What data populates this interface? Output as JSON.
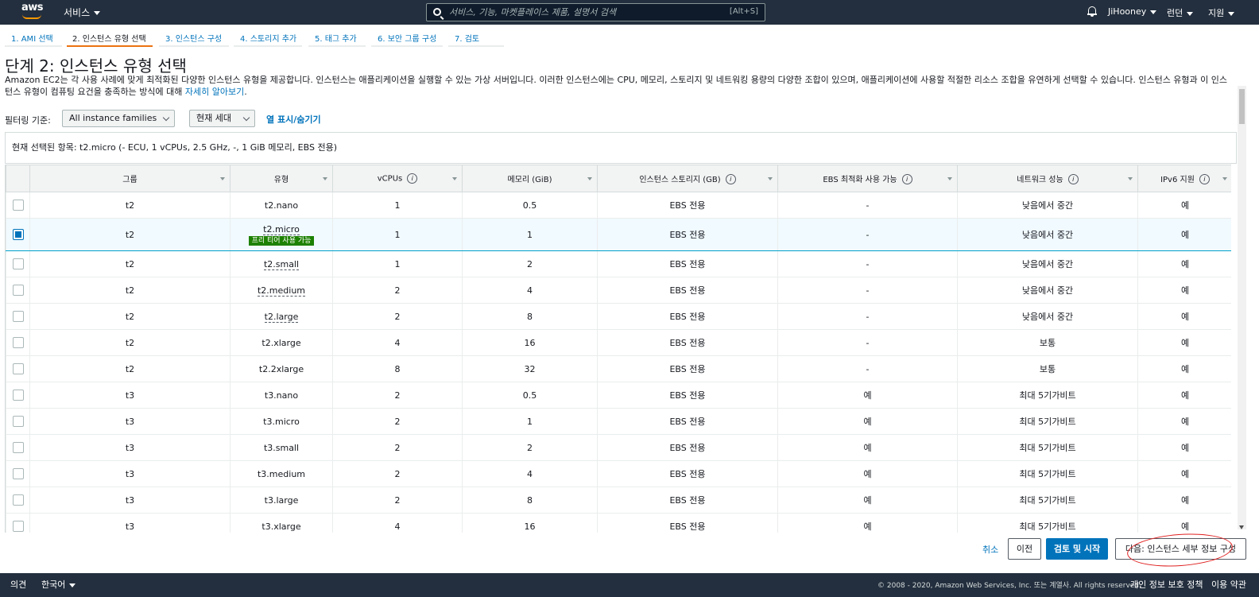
{
  "nav": {
    "logo": "aws",
    "services": "서비스",
    "search_placeholder": "서비스, 기능, 마켓플레이스 제품, 설명서 검색",
    "search_shortcut": "[Alt+S]",
    "user": "JiHooney",
    "region": "런던",
    "support": "지원"
  },
  "steps": [
    {
      "label": "1. AMI 선택"
    },
    {
      "label": "2. 인스턴스 유형 선택"
    },
    {
      "label": "3. 인스턴스 구성"
    },
    {
      "label": "4. 스토리지 추가"
    },
    {
      "label": "5. 태그 추가"
    },
    {
      "label": "6. 보안 그룹 구성"
    },
    {
      "label": "7. 검토"
    }
  ],
  "page": {
    "title": "단계 2: 인스턴스 유형 선택",
    "description": "Amazon EC2는 각 사용 사례에 맞게 최적화된 다양한 인스턴스 유형을 제공합니다. 인스턴스는 애플리케이션을 실행할 수 있는 가상 서버입니다. 이러한 인스턴스에는 CPU, 메모리, 스토리지 및 네트워킹 용량의 다양한 조합이 있으며, 애플리케이션에 사용할 적절한 리소스 조합을 유연하게 선택할 수 있습니다. 인스턴스 유형과 이 인스턴스 유형이 컴퓨팅 요건을 충족하는 방식에 대해",
    "learn_more": "자세히 알아보기",
    "desc_end": ".",
    "filter_label": "필터링 기준:",
    "filter_family": "All instance families",
    "filter_generation": "현재 세대",
    "toggle_columns": "열 표시/숨기기",
    "selected_text": "현재 선택된 항목: t2.micro (- ECU, 1 vCPUs, 2.5 GHz, -, 1 GiB 메모리, EBS 전용)"
  },
  "table": {
    "headers": {
      "group": "그룹",
      "type": "유형",
      "vcpus": "vCPUs",
      "memory": "메모리 (GiB)",
      "storage": "인스턴스 스토리지 (GB)",
      "ebs": "EBS 최적화 사용 가능",
      "network": "네트워크 성능",
      "ipv6": "IPv6 지원"
    },
    "info_glyph": "i",
    "free_tier_label": "프리 티어 사용 가능",
    "rows": [
      {
        "group": "t2",
        "type": "t2.nano",
        "vcpus": "1",
        "memory": "0.5",
        "storage": "EBS 전용",
        "ebs": "-",
        "network": "낮음에서 중간",
        "ipv6": "예",
        "selected": false,
        "dotted": false
      },
      {
        "group": "t2",
        "type": "t2.micro",
        "vcpus": "1",
        "memory": "1",
        "storage": "EBS 전용",
        "ebs": "-",
        "network": "낮음에서 중간",
        "ipv6": "예",
        "selected": true,
        "dotted": true,
        "free": true
      },
      {
        "group": "t2",
        "type": "t2.small",
        "vcpus": "1",
        "memory": "2",
        "storage": "EBS 전용",
        "ebs": "-",
        "network": "낮음에서 중간",
        "ipv6": "예",
        "selected": false,
        "dotted": true
      },
      {
        "group": "t2",
        "type": "t2.medium",
        "vcpus": "2",
        "memory": "4",
        "storage": "EBS 전용",
        "ebs": "-",
        "network": "낮음에서 중간",
        "ipv6": "예",
        "selected": false,
        "dotted": true
      },
      {
        "group": "t2",
        "type": "t2.large",
        "vcpus": "2",
        "memory": "8",
        "storage": "EBS 전용",
        "ebs": "-",
        "network": "낮음에서 중간",
        "ipv6": "예",
        "selected": false,
        "dotted": true
      },
      {
        "group": "t2",
        "type": "t2.xlarge",
        "vcpus": "4",
        "memory": "16",
        "storage": "EBS 전용",
        "ebs": "-",
        "network": "보통",
        "ipv6": "예",
        "selected": false,
        "dotted": false
      },
      {
        "group": "t2",
        "type": "t2.2xlarge",
        "vcpus": "8",
        "memory": "32",
        "storage": "EBS 전용",
        "ebs": "-",
        "network": "보통",
        "ipv6": "예",
        "selected": false,
        "dotted": false
      },
      {
        "group": "t3",
        "type": "t3.nano",
        "vcpus": "2",
        "memory": "0.5",
        "storage": "EBS 전용",
        "ebs": "예",
        "network": "최대 5기가비트",
        "ipv6": "예",
        "selected": false,
        "dotted": false
      },
      {
        "group": "t3",
        "type": "t3.micro",
        "vcpus": "2",
        "memory": "1",
        "storage": "EBS 전용",
        "ebs": "예",
        "network": "최대 5기가비트",
        "ipv6": "예",
        "selected": false,
        "dotted": false
      },
      {
        "group": "t3",
        "type": "t3.small",
        "vcpus": "2",
        "memory": "2",
        "storage": "EBS 전용",
        "ebs": "예",
        "network": "최대 5기가비트",
        "ipv6": "예",
        "selected": false,
        "dotted": false
      },
      {
        "group": "t3",
        "type": "t3.medium",
        "vcpus": "2",
        "memory": "4",
        "storage": "EBS 전용",
        "ebs": "예",
        "network": "최대 5기가비트",
        "ipv6": "예",
        "selected": false,
        "dotted": false
      },
      {
        "group": "t3",
        "type": "t3.large",
        "vcpus": "2",
        "memory": "8",
        "storage": "EBS 전용",
        "ebs": "예",
        "network": "최대 5기가비트",
        "ipv6": "예",
        "selected": false,
        "dotted": false
      },
      {
        "group": "t3",
        "type": "t3.xlarge",
        "vcpus": "4",
        "memory": "16",
        "storage": "EBS 전용",
        "ebs": "예",
        "network": "최대 5기가비트",
        "ipv6": "예",
        "selected": false,
        "dotted": false
      }
    ]
  },
  "actions": {
    "cancel": "취소",
    "previous": "이전",
    "review_launch": "검토 및 시작",
    "next": "다음: 인스턴스 세부 정보 구성"
  },
  "footer": {
    "feedback": "의견",
    "language": "한국어",
    "copyright": "© 2008 - 2020, Amazon Web Services, Inc. 또는 계열사. All rights reserved.",
    "privacy": "개인 정보 보호 정책",
    "terms": "이용 약관"
  },
  "colors": {
    "nav_bg": "#232f3e",
    "accent": "#ec7211",
    "link": "#0073bb",
    "free_tier": "#1d8102",
    "annotation": "#e02020"
  }
}
